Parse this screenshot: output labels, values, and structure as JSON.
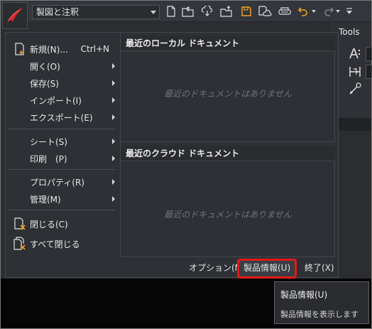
{
  "quick_access": {
    "workspace": "製図と注釈",
    "icons": [
      "new-icon",
      "open-icon",
      "cloud-download-icon",
      "cloud-upload-icon",
      "save-icon",
      "save-as-cloud-icon",
      "plot-icon",
      "undo-icon",
      "redo-icon",
      "customize-icon"
    ]
  },
  "ribbon": {
    "tab_label": "Tools"
  },
  "app_menu": {
    "items": [
      {
        "label": "新規(N)...",
        "shortcut": "Ctrl+N",
        "has_submenu": false
      },
      {
        "label": "開く(O)",
        "has_submenu": true
      },
      {
        "label": "保存(S)",
        "has_submenu": true
      },
      {
        "label": "インポート(I)",
        "has_submenu": true
      },
      {
        "label": "エクスポート(E)",
        "has_submenu": true
      },
      {
        "label": "シート(S)",
        "has_submenu": true
      },
      {
        "label": "印刷　(P)",
        "has_submenu": true
      },
      {
        "label": "プロパティ(R)",
        "has_submenu": true
      },
      {
        "label": "管理(M)",
        "has_submenu": true
      },
      {
        "label": "閉じる(C)",
        "has_submenu": false
      },
      {
        "label": "すべて閉じる",
        "has_submenu": false
      }
    ],
    "recent_local": {
      "title": "最近のローカル ドキュメント",
      "empty_text": "最近のドキュメントはありません"
    },
    "recent_cloud": {
      "title": "最近のクラウド ドキュメント",
      "empty_text": "最近のドキュメントはありません"
    },
    "footer": {
      "options": "オプション(N)",
      "product_info": "製品情報(U)",
      "exit": "終了(X)"
    }
  },
  "tooltip": {
    "title": "製品情報(U)",
    "description": "製品情報を表示します"
  },
  "colors": {
    "accent_red": "#e21a1a",
    "logo_red": "#d9262b",
    "save_orange": "#f0a020"
  }
}
